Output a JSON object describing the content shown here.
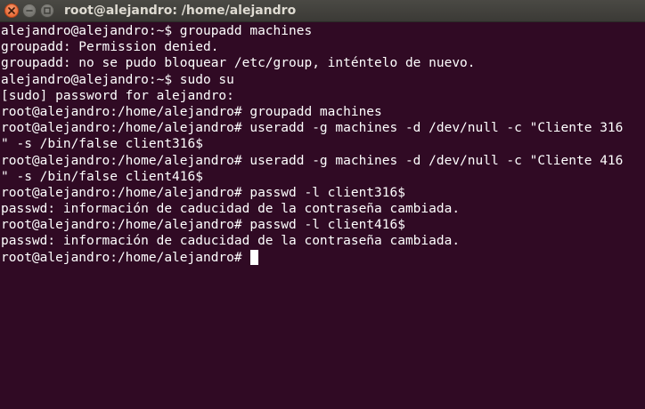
{
  "window": {
    "title": "root@alejandro: /home/alejandro"
  },
  "colors": {
    "terminal_background": "#300a24",
    "terminal_text": "#ffffff",
    "titlebar": "#3c3b37",
    "close_button": "#e45a23"
  },
  "icons": {
    "close": "close-icon",
    "minimize": "minimize-icon",
    "maximize": "maximize-icon"
  },
  "terminal": {
    "lines": [
      "alejandro@alejandro:~$ groupadd machines",
      "groupadd: Permission denied.",
      "groupadd: no se pudo bloquear /etc/group, inténtelo de nuevo.",
      "alejandro@alejandro:~$ sudo su",
      "[sudo] password for alejandro:",
      "root@alejandro:/home/alejandro# groupadd machines",
      "root@alejandro:/home/alejandro# useradd -g machines -d /dev/null -c \"Cliente 316",
      "\" -s /bin/false client316$",
      "root@alejandro:/home/alejandro# useradd -g machines -d /dev/null -c \"Cliente 416",
      "\" -s /bin/false client416$",
      "root@alejandro:/home/alejandro# passwd -l client316$",
      "passwd: información de caducidad de la contraseña cambiada.",
      "root@alejandro:/home/alejandro# passwd -l client416$",
      "passwd: información de caducidad de la contraseña cambiada.",
      "root@alejandro:/home/alejandro# "
    ]
  }
}
